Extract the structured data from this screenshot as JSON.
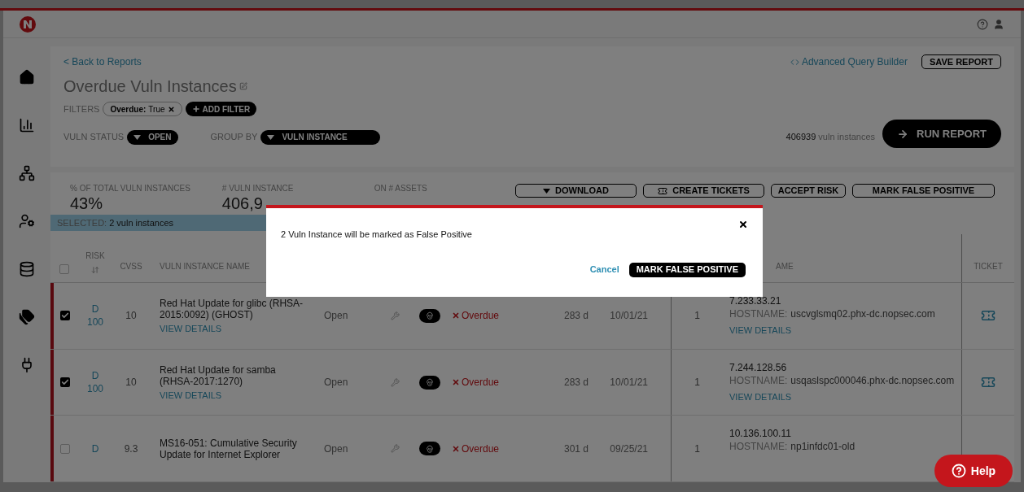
{
  "back_link": "< Back to Reports",
  "title": "Overdue Vuln Instances",
  "advanced_link": "Advanced Query Builder",
  "save_button": "SAVE REPORT",
  "filters": {
    "label": "FILTERS",
    "chips": [
      {
        "key": "Overdue:",
        "value": "True"
      }
    ],
    "add_button": "ADD FILTER"
  },
  "vuln_status": {
    "label": "VULN STATUS",
    "value": "OPEN"
  },
  "group_by": {
    "label": "GROUP BY",
    "value": "VULN INSTANCE"
  },
  "count": {
    "number": "406939",
    "unit": "vuln instances"
  },
  "run_button": "RUN REPORT",
  "stats": [
    {
      "label": "% OF TOTAL VULN INSTANCES",
      "value": "43%"
    },
    {
      "label": "# VULN INSTANCE",
      "value": "406,9"
    },
    {
      "label": "ON # ASSETS"
    }
  ],
  "actions": [
    {
      "label": "DOWNLOAD",
      "kind": "download"
    },
    {
      "label": "CREATE TICKETS",
      "kind": "ticket"
    },
    {
      "label": "ACCEPT RISK",
      "kind": "plain"
    },
    {
      "label": "MARK FALSE POSITIVE",
      "kind": "plain"
    }
  ],
  "selection": {
    "label": "SELECTED:",
    "value": "2 vuln instances"
  },
  "table": {
    "header_checkbox": {
      "checked": false
    },
    "columns": {
      "risk": "RISK",
      "cvss": "CVSS",
      "name": "VULN INSTANCE NAME",
      "asset": "AME",
      "ticket": "TICKET"
    },
    "rows": [
      {
        "checked": true,
        "grade": "D",
        "score": "100",
        "cvss": "10",
        "name": "Red Hat Update for glibc (RHSA-2015:0092) (GHOST)",
        "details": "VIEW DETAILS",
        "status": "Open",
        "overdue": "Overdue",
        "age": "283 d",
        "date": "10/01/21",
        "count": "1",
        "ip": "7.233.33.21",
        "host_label": "HOSTNAME:",
        "host": "uscvglsmq02.phx-dc.nopsec.com",
        "asset_details": "VIEW DETAILS",
        "ticket": true
      },
      {
        "checked": true,
        "grade": "D",
        "score": "100",
        "cvss": "10",
        "name": "Red Hat Update for samba (RHSA-2017:1270)",
        "details": "VIEW DETAILS",
        "status": "Open",
        "overdue": "Overdue",
        "age": "283 d",
        "date": "10/01/21",
        "count": "1",
        "ip": "7.244.128.56",
        "host_label": "HOSTNAME:",
        "host": "usqaslspc000046.phx-dc.nopsec.com",
        "asset_details": "VIEW DETAILS",
        "ticket": true
      },
      {
        "checked": false,
        "grade": "D",
        "cvss": "9.3",
        "name": "MS16-051: Cumulative Security Update for Internet Explorer",
        "status": "Open",
        "overdue": "Overdue",
        "age": "301 d",
        "date": "09/25/21",
        "count": "1",
        "ip": "10.136.100.11",
        "host_label": "HOSTNAME:",
        "host": "np1infdc01-old"
      }
    ]
  },
  "modal": {
    "message": "2 Vuln Instance will be marked as False Positive",
    "cancel": "Cancel",
    "confirm": "MARK FALSE POSITIVE"
  },
  "help_button": "Help"
}
